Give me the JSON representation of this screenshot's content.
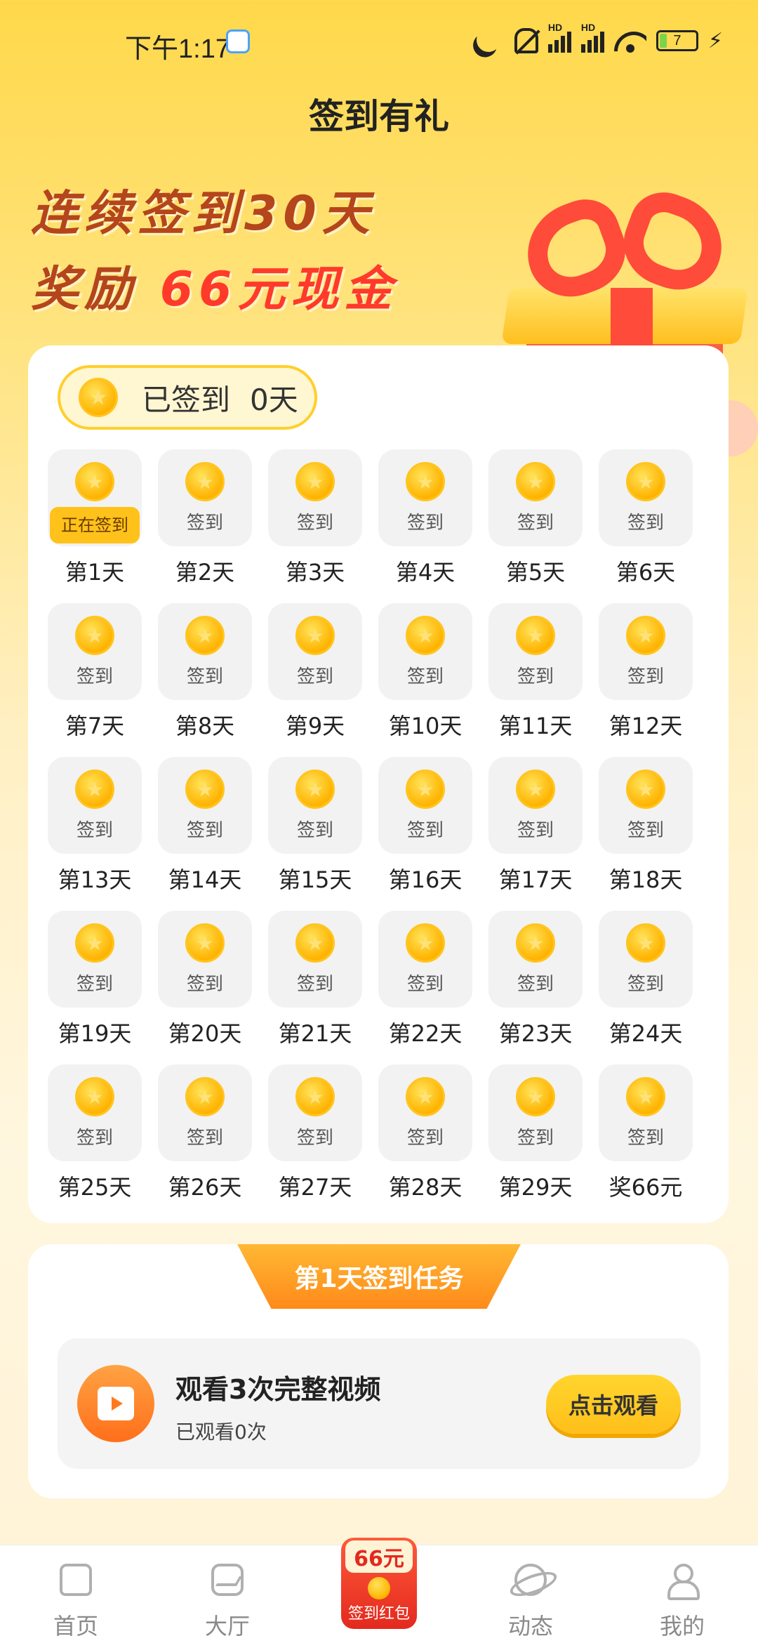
{
  "status_bar": {
    "time": "下午1:17",
    "battery": "7",
    "hd1": "HD",
    "hd2": "HD"
  },
  "page_title": "签到有礼",
  "banner": {
    "line1": "连续签到30天",
    "line2_prefix": "奖励 ",
    "line2_highlight": "66元现金"
  },
  "signed": {
    "label": "已签到",
    "count": "0天"
  },
  "days": [
    {
      "action": "正在签到",
      "label": "第1天",
      "current": true
    },
    {
      "action": "签到",
      "label": "第2天"
    },
    {
      "action": "签到",
      "label": "第3天"
    },
    {
      "action": "签到",
      "label": "第4天"
    },
    {
      "action": "签到",
      "label": "第5天"
    },
    {
      "action": "签到",
      "label": "第6天"
    },
    {
      "action": "签到",
      "label": "第7天"
    },
    {
      "action": "签到",
      "label": "第8天"
    },
    {
      "action": "签到",
      "label": "第9天"
    },
    {
      "action": "签到",
      "label": "第10天"
    },
    {
      "action": "签到",
      "label": "第11天"
    },
    {
      "action": "签到",
      "label": "第12天"
    },
    {
      "action": "签到",
      "label": "第13天"
    },
    {
      "action": "签到",
      "label": "第14天"
    },
    {
      "action": "签到",
      "label": "第15天"
    },
    {
      "action": "签到",
      "label": "第16天"
    },
    {
      "action": "签到",
      "label": "第17天"
    },
    {
      "action": "签到",
      "label": "第18天"
    },
    {
      "action": "签到",
      "label": "第19天"
    },
    {
      "action": "签到",
      "label": "第20天"
    },
    {
      "action": "签到",
      "label": "第21天"
    },
    {
      "action": "签到",
      "label": "第22天"
    },
    {
      "action": "签到",
      "label": "第23天"
    },
    {
      "action": "签到",
      "label": "第24天"
    },
    {
      "action": "签到",
      "label": "第25天"
    },
    {
      "action": "签到",
      "label": "第26天"
    },
    {
      "action": "签到",
      "label": "第27天"
    },
    {
      "action": "签到",
      "label": "第28天"
    },
    {
      "action": "签到",
      "label": "第29天"
    },
    {
      "action": "签到",
      "label": "奖66元"
    }
  ],
  "task": {
    "tab_title": "第1天签到任务",
    "title": "观看3次完整视频",
    "progress": "已观看0次",
    "button": "点击观看"
  },
  "nav": {
    "home": "首页",
    "hall": "大厅",
    "redpack_amount": "66元",
    "redpack_label": "签到红包",
    "feed": "动态",
    "me": "我的"
  },
  "colors": {
    "accent": "#ffc21a",
    "banner_text": "#b5451b",
    "banner_highlight": "#ff3a2a",
    "task_tab": "#ff8a1a"
  }
}
